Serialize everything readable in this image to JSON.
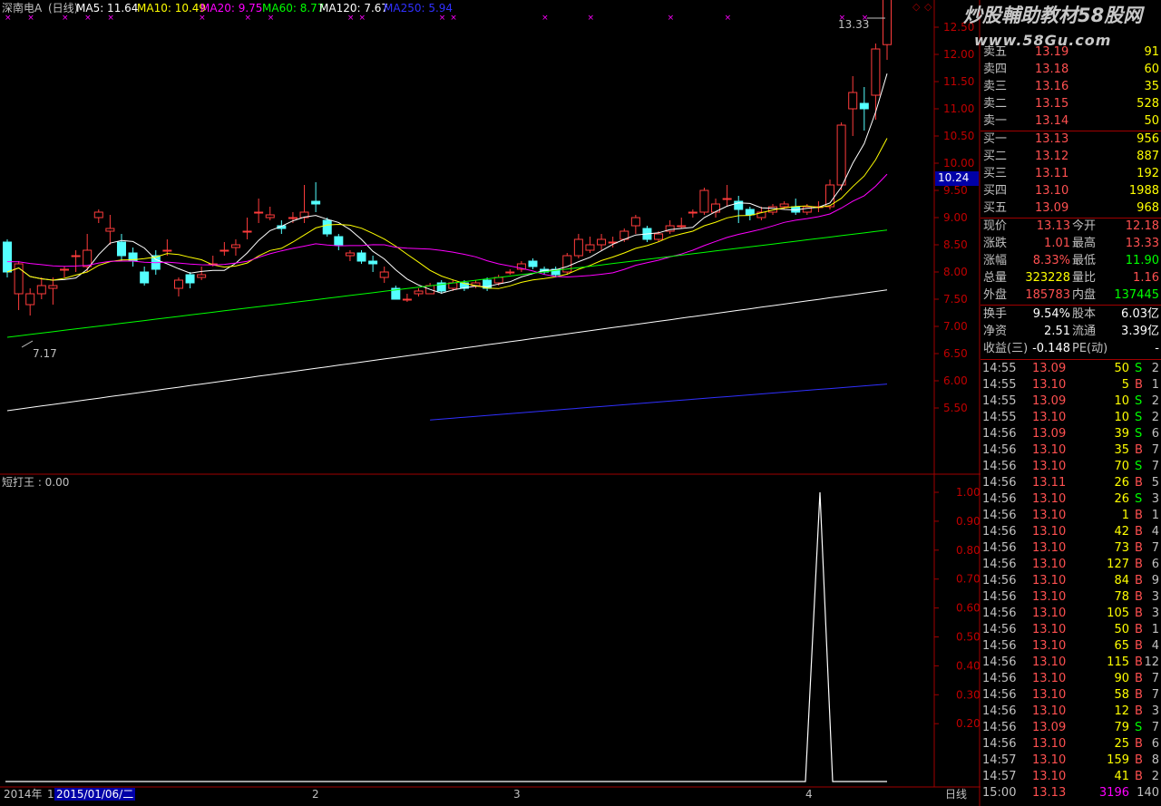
{
  "header": {
    "stock_name": "深南电A",
    "period": "(日线)",
    "ma": [
      {
        "label": "MA5: 11.64",
        "color": "#ffffff"
      },
      {
        "label": "MA10: 10.49",
        "color": "#ffff00"
      },
      {
        "label": "MA20: 9.75",
        "color": "#ff00ff"
      },
      {
        "label": "MA60: 8.77",
        "color": "#00ff00"
      },
      {
        "label": "MA120: 7.67",
        "color": "#ffffff"
      },
      {
        "label": "MA250: 5.94",
        "color": "#3030ff"
      }
    ]
  },
  "watermark": {
    "line1": "炒股輔助教材58股网",
    "line2": "www.58Gu.com"
  },
  "price_axis": [
    "12.50",
    "12.00",
    "11.50",
    "11.00",
    "10.50",
    "10.00",
    "9.50",
    "9.00",
    "8.50",
    "8.00",
    "7.50",
    "7.00",
    "6.50",
    "6.00",
    "5.50"
  ],
  "current_price_tag": "10.24",
  "high_label": "13.33",
  "low_label": "7.17",
  "indicator": {
    "title": "短打王 : 0.00",
    "axis": [
      "1.00",
      "0.90",
      "0.80",
      "0.70",
      "0.60",
      "0.50",
      "0.40",
      "0.30",
      "0.20"
    ]
  },
  "bottom_bar": {
    "year": "2014年",
    "tick1": "1",
    "date": "2015/01/06/二",
    "tick2": "2",
    "tick3": "3",
    "tick4": "4",
    "period_button": "日线"
  },
  "colors": {
    "up": "#ff3c3c",
    "down": "#54ffff",
    "grid": "#a00000"
  },
  "order_book": {
    "sell": [
      {
        "label": "卖五",
        "price": "13.19",
        "vol": "91"
      },
      {
        "label": "卖四",
        "price": "13.18",
        "vol": "60"
      },
      {
        "label": "卖三",
        "price": "13.16",
        "vol": "35"
      },
      {
        "label": "卖二",
        "price": "13.15",
        "vol": "528"
      },
      {
        "label": "卖一",
        "price": "13.14",
        "vol": "50"
      }
    ],
    "buy": [
      {
        "label": "买一",
        "price": "13.13",
        "vol": "956"
      },
      {
        "label": "买二",
        "price": "13.12",
        "vol": "887"
      },
      {
        "label": "买三",
        "price": "13.11",
        "vol": "192"
      },
      {
        "label": "买四",
        "price": "13.10",
        "vol": "1988"
      },
      {
        "label": "买五",
        "price": "13.09",
        "vol": "968"
      }
    ]
  },
  "quote": [
    {
      "l1": "现价",
      "v1": "13.13",
      "l2": "今开",
      "v2": "12.18",
      "c1": "#ff5050",
      "c2": "#ff5050"
    },
    {
      "l1": "涨跌",
      "v1": "1.01",
      "l2": "最高",
      "v2": "13.33",
      "c1": "#ff5050",
      "c2": "#ff5050"
    },
    {
      "l1": "涨幅",
      "v1": "8.33%",
      "l2": "最低",
      "v2": "11.90",
      "c1": "#ff5050",
      "c2": "#00ff00"
    },
    {
      "l1": "总量",
      "v1": "323228",
      "l2": "量比",
      "v2": "1.16",
      "c1": "#ffff00",
      "c2": "#ff5050"
    },
    {
      "l1": "外盘",
      "v1": "185783",
      "l2": "内盘",
      "v2": "137445",
      "c1": "#ff5050",
      "c2": "#00ff00"
    }
  ],
  "stats": [
    {
      "l1": "换手",
      "v1": "9.54%",
      "l2": "股本",
      "v2": "6.03亿"
    },
    {
      "l1": "净资",
      "v1": "2.51",
      "l2": "流通",
      "v2": "3.39亿"
    },
    {
      "l1": "收益(三)",
      "v1": "-0.148",
      "l2": "PE(动)",
      "v2": "-"
    }
  ],
  "ticks": [
    {
      "time": "14:55",
      "price": "13.09",
      "vol": "50",
      "dir": "S",
      "n": "2"
    },
    {
      "time": "14:55",
      "price": "13.10",
      "vol": "5",
      "dir": "B",
      "n": "1"
    },
    {
      "time": "14:55",
      "price": "13.09",
      "vol": "10",
      "dir": "S",
      "n": "2"
    },
    {
      "time": "14:55",
      "price": "13.10",
      "vol": "10",
      "dir": "S",
      "n": "2"
    },
    {
      "time": "14:56",
      "price": "13.09",
      "vol": "39",
      "dir": "S",
      "n": "6"
    },
    {
      "time": "14:56",
      "price": "13.10",
      "vol": "35",
      "dir": "B",
      "n": "7"
    },
    {
      "time": "14:56",
      "price": "13.10",
      "vol": "70",
      "dir": "S",
      "n": "7"
    },
    {
      "time": "14:56",
      "price": "13.11",
      "vol": "26",
      "dir": "B",
      "n": "5"
    },
    {
      "time": "14:56",
      "price": "13.10",
      "vol": "26",
      "dir": "S",
      "n": "3"
    },
    {
      "time": "14:56",
      "price": "13.10",
      "vol": "1",
      "dir": "B",
      "n": "1"
    },
    {
      "time": "14:56",
      "price": "13.10",
      "vol": "42",
      "dir": "B",
      "n": "4"
    },
    {
      "time": "14:56",
      "price": "13.10",
      "vol": "73",
      "dir": "B",
      "n": "7"
    },
    {
      "time": "14:56",
      "price": "13.10",
      "vol": "127",
      "dir": "B",
      "n": "6"
    },
    {
      "time": "14:56",
      "price": "13.10",
      "vol": "84",
      "dir": "B",
      "n": "9"
    },
    {
      "time": "14:56",
      "price": "13.10",
      "vol": "78",
      "dir": "B",
      "n": "3"
    },
    {
      "time": "14:56",
      "price": "13.10",
      "vol": "105",
      "dir": "B",
      "n": "3"
    },
    {
      "time": "14:56",
      "price": "13.10",
      "vol": "50",
      "dir": "B",
      "n": "1"
    },
    {
      "time": "14:56",
      "price": "13.10",
      "vol": "65",
      "dir": "B",
      "n": "4"
    },
    {
      "time": "14:56",
      "price": "13.10",
      "vol": "115",
      "dir": "B",
      "n": "12"
    },
    {
      "time": "14:56",
      "price": "13.10",
      "vol": "90",
      "dir": "B",
      "n": "7"
    },
    {
      "time": "14:56",
      "price": "13.10",
      "vol": "58",
      "dir": "B",
      "n": "7"
    },
    {
      "time": "14:56",
      "price": "13.10",
      "vol": "12",
      "dir": "B",
      "n": "3"
    },
    {
      "time": "14:56",
      "price": "13.09",
      "vol": "79",
      "dir": "S",
      "n": "7"
    },
    {
      "time": "14:56",
      "price": "13.10",
      "vol": "25",
      "dir": "B",
      "n": "6"
    },
    {
      "time": "14:57",
      "price": "13.10",
      "vol": "159",
      "dir": "B",
      "n": "8"
    },
    {
      "time": "14:57",
      "price": "13.10",
      "vol": "41",
      "dir": "B",
      "n": "2"
    },
    {
      "time": "15:00",
      "price": "13.13",
      "vol": "3196",
      "dir": "",
      "n": "140"
    }
  ],
  "chart_data": {
    "type": "candlestick",
    "ylim": [
      5.25,
      13.5
    ],
    "candles": [
      [
        8.55,
        8.0,
        8.6,
        7.9
      ],
      [
        7.6,
        8.15,
        8.2,
        7.3
      ],
      [
        7.4,
        7.6,
        7.7,
        7.2
      ],
      [
        7.6,
        7.75,
        7.9,
        7.5
      ],
      [
        7.7,
        7.75,
        7.9,
        7.4
      ],
      [
        8.05,
        8.05,
        8.1,
        7.9
      ],
      [
        8.3,
        8.3,
        8.4,
        8.0
      ],
      [
        8.1,
        8.4,
        8.7,
        8.0
      ],
      [
        9.0,
        9.1,
        9.15,
        8.9
      ],
      [
        8.75,
        8.8,
        9.05,
        8.5
      ],
      [
        8.55,
        8.3,
        8.7,
        8.2
      ],
      [
        8.35,
        8.2,
        8.45,
        8.1
      ],
      [
        8.0,
        7.8,
        8.1,
        7.75
      ],
      [
        8.3,
        8.05,
        8.4,
        7.95
      ],
      [
        8.4,
        8.4,
        8.6,
        8.3
      ],
      [
        7.7,
        7.85,
        7.9,
        7.55
      ],
      [
        7.95,
        7.8,
        8.0,
        7.7
      ],
      [
        7.9,
        7.95,
        8.1,
        7.85
      ],
      [
        8.15,
        8.15,
        8.3,
        8.1
      ],
      [
        8.4,
        8.4,
        8.55,
        8.3
      ],
      [
        8.45,
        8.5,
        8.6,
        8.3
      ],
      [
        8.75,
        8.75,
        9.0,
        8.6
      ],
      [
        9.1,
        9.1,
        9.35,
        8.9
      ],
      [
        9.0,
        9.05,
        9.2,
        8.95
      ],
      [
        8.85,
        8.8,
        8.95,
        8.7
      ],
      [
        9.0,
        9.0,
        9.1,
        8.9
      ],
      [
        9.0,
        9.1,
        9.6,
        8.9
      ],
      [
        9.3,
        9.25,
        9.65,
        9.1
      ],
      [
        8.95,
        8.7,
        9.0,
        8.65
      ],
      [
        8.65,
        8.5,
        8.7,
        8.4
      ],
      [
        8.3,
        8.35,
        8.4,
        8.2
      ],
      [
        8.35,
        8.2,
        8.4,
        8.15
      ],
      [
        8.2,
        8.15,
        8.3,
        8.0
      ],
      [
        7.9,
        8.0,
        8.1,
        7.8
      ],
      [
        7.7,
        7.5,
        7.75,
        7.5
      ],
      [
        7.5,
        7.5,
        7.6,
        7.45
      ],
      [
        7.6,
        7.65,
        7.7,
        7.55
      ],
      [
        7.6,
        7.75,
        7.8,
        7.6
      ],
      [
        7.8,
        7.65,
        7.85,
        7.6
      ],
      [
        7.7,
        7.8,
        7.85,
        7.65
      ],
      [
        7.8,
        7.7,
        7.85,
        7.65
      ],
      [
        7.75,
        7.8,
        7.85,
        7.7
      ],
      [
        7.85,
        7.7,
        7.9,
        7.65
      ],
      [
        7.8,
        7.9,
        7.95,
        7.75
      ],
      [
        8.0,
        8.0,
        8.05,
        7.95
      ],
      [
        8.05,
        8.15,
        8.2,
        8.0
      ],
      [
        8.2,
        8.1,
        8.25,
        8.05
      ],
      [
        8.05,
        8.0,
        8.1,
        7.95
      ],
      [
        8.05,
        7.95,
        8.1,
        7.9
      ],
      [
        8.0,
        8.3,
        8.35,
        7.95
      ],
      [
        8.3,
        8.6,
        8.7,
        8.25
      ],
      [
        8.4,
        8.5,
        8.65,
        8.35
      ],
      [
        8.5,
        8.6,
        8.7,
        8.4
      ],
      [
        8.55,
        8.55,
        8.65,
        8.45
      ],
      [
        8.6,
        8.75,
        8.8,
        8.55
      ],
      [
        8.85,
        9.0,
        9.05,
        8.7
      ],
      [
        8.8,
        8.6,
        8.85,
        8.55
      ],
      [
        8.6,
        8.7,
        8.75,
        8.55
      ],
      [
        8.75,
        8.85,
        8.95,
        8.7
      ],
      [
        8.85,
        8.85,
        9.0,
        8.8
      ],
      [
        9.1,
        9.1,
        9.15,
        9.0
      ],
      [
        9.1,
        9.5,
        9.55,
        9.05
      ],
      [
        9.1,
        9.25,
        9.35,
        9.0
      ],
      [
        9.35,
        9.35,
        9.6,
        9.2
      ],
      [
        9.3,
        9.15,
        9.4,
        8.9
      ],
      [
        9.15,
        9.05,
        9.2,
        8.95
      ],
      [
        9.0,
        9.1,
        9.2,
        8.95
      ],
      [
        9.1,
        9.2,
        9.25,
        9.05
      ],
      [
        9.2,
        9.25,
        9.3,
        9.15
      ],
      [
        9.2,
        9.1,
        9.35,
        9.05
      ],
      [
        9.1,
        9.2,
        9.25,
        9.05
      ],
      [
        9.2,
        9.2,
        9.3,
        9.1
      ],
      [
        9.2,
        9.6,
        9.7,
        9.15
      ],
      [
        9.6,
        10.7,
        10.75,
        9.5
      ],
      [
        11.0,
        11.3,
        11.6,
        10.5
      ],
      [
        11.1,
        11.0,
        11.4,
        10.6
      ],
      [
        11.25,
        12.1,
        12.2,
        10.8
      ],
      [
        12.18,
        13.13,
        13.33,
        11.9
      ]
    ]
  }
}
